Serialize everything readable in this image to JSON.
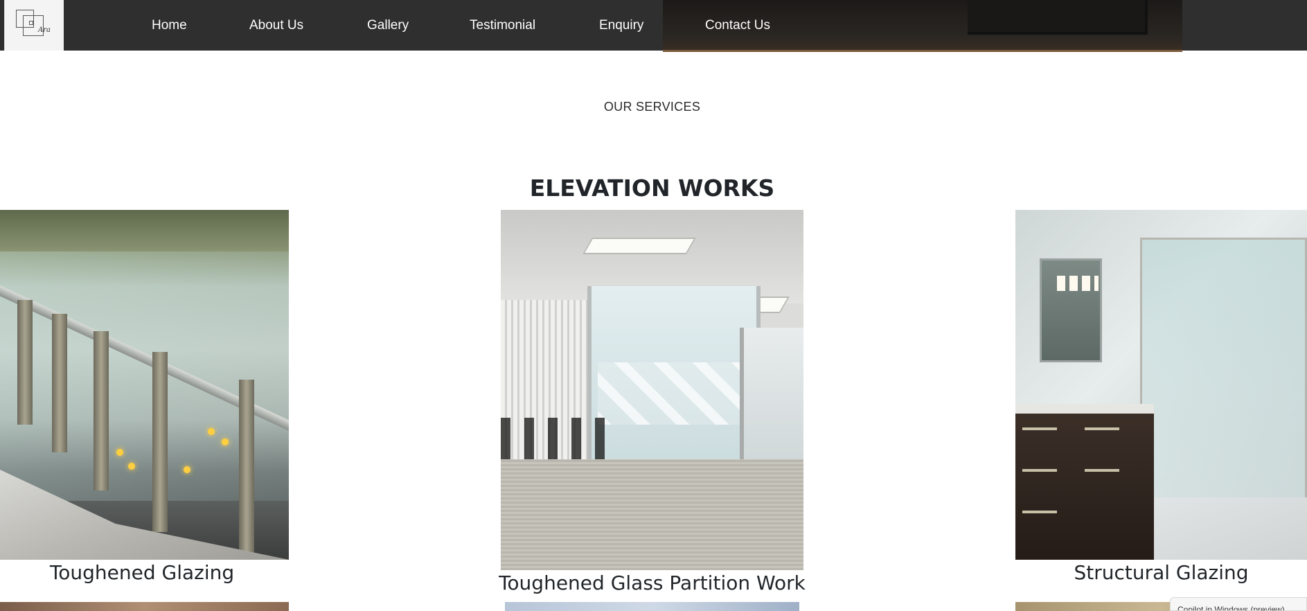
{
  "navbar": {
    "logo_text": "Ara",
    "links": [
      {
        "label": "Home"
      },
      {
        "label": "About Us"
      },
      {
        "label": "Gallery"
      },
      {
        "label": "Testimonial"
      },
      {
        "label": "Enquiry"
      },
      {
        "label": "Contact Us"
      }
    ]
  },
  "services": {
    "label": "OUR SERVICES"
  },
  "elevation": {
    "title": "ELEVATION WORKS",
    "cards": [
      {
        "caption": "Toughened Glazing"
      },
      {
        "caption": "Toughened Glass Partition Work"
      },
      {
        "caption": "Structural Glazing"
      }
    ]
  },
  "toast": {
    "text": "Copilot in Windows (preview)"
  }
}
